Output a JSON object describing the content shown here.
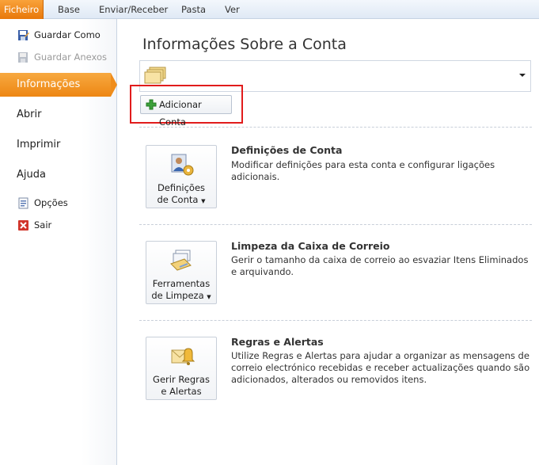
{
  "ribbon": {
    "tabs": [
      "Ficheiro",
      "Base",
      "Enviar/Receber",
      "Pasta",
      "Ver"
    ]
  },
  "nav": {
    "save_as": "Guardar Como",
    "save_attachments": "Guardar Anexos",
    "info": "Informações",
    "open": "Abrir",
    "print": "Imprimir",
    "help": "Ajuda",
    "options": "Opções",
    "exit": "Sair"
  },
  "main": {
    "title": "Informações Sobre a Conta",
    "add_account": "Adicionar Conta",
    "sections": [
      {
        "button_line1": "Definições",
        "button_line2": "de Conta",
        "title": "Definições de Conta",
        "desc": "Modificar definições para esta conta e configurar ligações adicionais.",
        "icon": "account-settings-icon"
      },
      {
        "button_line1": "Ferramentas",
        "button_line2": "de Limpeza",
        "title": "Limpeza da Caixa de Correio",
        "desc": "Gerir o tamanho da caixa de correio ao esvaziar Itens Eliminados e arquivando.",
        "icon": "cleanup-tools-icon"
      },
      {
        "button_line1": "Gerir Regras",
        "button_line2": "e Alertas",
        "title": "Regras e Alertas",
        "desc": "Utilize Regras e Alertas para ajudar a organizar as mensagens de correio electrónico recebidas e receber actualizações quando são adicionados, alterados ou removidos itens.",
        "icon": "rules-alerts-icon"
      }
    ]
  },
  "colors": {
    "file_tab": "#e8780a",
    "selected_nav": "#ed8613",
    "highlight": "#e11c1c"
  }
}
